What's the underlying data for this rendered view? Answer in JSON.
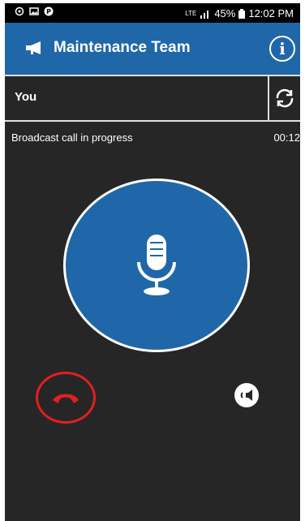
{
  "status_bar": {
    "left_icons": [
      "settings-icon",
      "gallery-icon",
      "p-badge-icon"
    ],
    "network": "LTE",
    "battery": "45%",
    "time": "12:02 PM"
  },
  "app_bar": {
    "title": "Maintenance Team",
    "icon": "megaphone-icon",
    "info_label": "i"
  },
  "participant": {
    "name": "You",
    "switch_icon": "switch-camera-icon"
  },
  "call": {
    "status": "Broadcast call in progress",
    "elapsed": "00:12",
    "mic_icon": "microphone-icon",
    "end_icon": "end-call-icon",
    "speaker_icon": "speaker-icon"
  },
  "colors": {
    "accent": "#1f67a8",
    "background": "#262626",
    "end_call": "#e02020"
  }
}
